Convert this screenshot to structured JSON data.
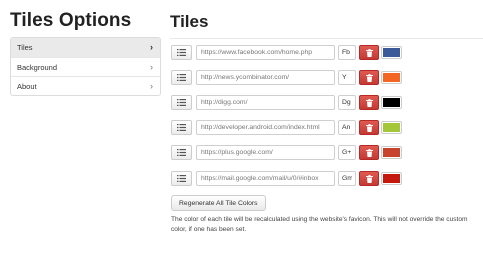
{
  "app_title": "Tiles Options",
  "section_title": "Tiles",
  "sidebar": {
    "items": [
      {
        "label": "Tiles",
        "active": true
      },
      {
        "label": "Background",
        "active": false
      },
      {
        "label": "About",
        "active": false
      }
    ]
  },
  "tiles": [
    {
      "url": "https://www.facebook.com/home.php",
      "abbr": "Fb",
      "color": "#3b5998"
    },
    {
      "url": "http://news.ycombinator.com/",
      "abbr": "Y",
      "color": "#f26522"
    },
    {
      "url": "http://digg.com/",
      "abbr": "Dg",
      "color": "#000000"
    },
    {
      "url": "http://developer.android.com/index.html",
      "abbr": "An",
      "color": "#a4c639"
    },
    {
      "url": "https://plus.google.com/",
      "abbr": "G+",
      "color": "#c8432e"
    },
    {
      "url": "https://mail.google.com/mail/u/0/#inbox",
      "abbr": "Gm",
      "color": "#c4170e"
    }
  ],
  "regenerate_label": "Regenerate All Tile Colors",
  "help_text": "The color of each tile will be recalculated using the website's favicon. This will not override the custom color, if one has been set.",
  "icons": {
    "drag": "list-icon",
    "delete": "trash-icon",
    "chevron": "chevron-right-icon"
  }
}
